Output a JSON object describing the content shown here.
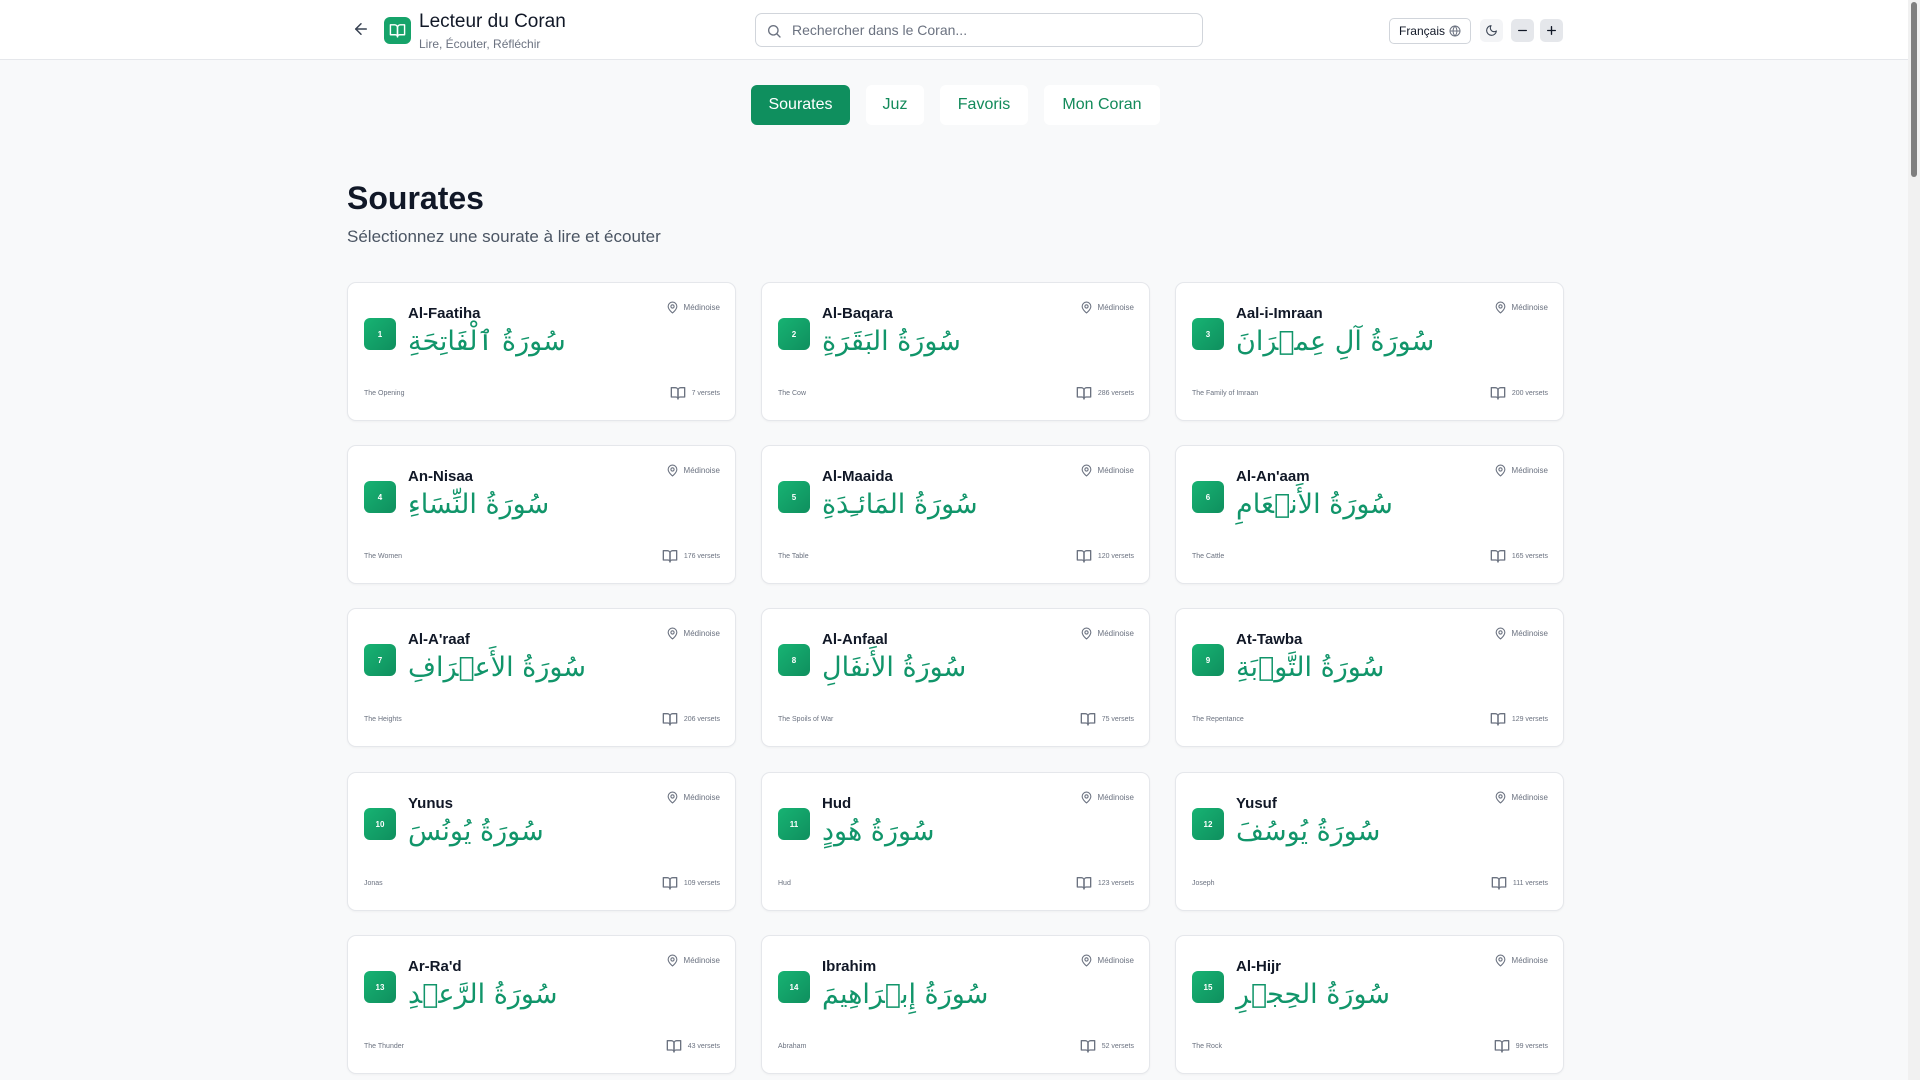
{
  "header": {
    "title": "Lecteur du Coran",
    "subtitle": "Lire, Écouter, Réfléchir",
    "search_placeholder": "Rechercher dans le Coran...",
    "language": "Français"
  },
  "tabs": [
    {
      "label": "Sourates",
      "active": true
    },
    {
      "label": "Juz",
      "active": false
    },
    {
      "label": "Favoris",
      "active": false
    },
    {
      "label": "Mon Coran",
      "active": false
    }
  ],
  "section": {
    "title": "Sourates",
    "subtitle": "Sélectionnez une sourate à lire et écouter"
  },
  "colors": {
    "accent": "#0f8f5e",
    "arabic": "#11956a"
  },
  "surahs": [
    {
      "number": "1",
      "name": "Al-Faatiha",
      "arabic": "سُورَةُ ٱلْفَاتِحَةِ",
      "english": "The Opening",
      "place": "Médinoise",
      "verses": "7 versets"
    },
    {
      "number": "2",
      "name": "Al-Baqara",
      "arabic": "سُورَةُ البَقَرَةِ",
      "english": "The Cow",
      "place": "Médinoise",
      "verses": "286 versets"
    },
    {
      "number": "3",
      "name": "Aal-i-Imraan",
      "arabic": "سُورَةُ آلِ عِمۡرَانَ",
      "english": "The Family of Imraan",
      "place": "Médinoise",
      "verses": "200 versets"
    },
    {
      "number": "4",
      "name": "An-Nisaa",
      "arabic": "سُورَةُ النِّسَاءِ",
      "english": "The Women",
      "place": "Médinoise",
      "verses": "176 versets"
    },
    {
      "number": "5",
      "name": "Al-Maaida",
      "arabic": "سُورَةُ المَائـِدَةِ",
      "english": "The Table",
      "place": "Médinoise",
      "verses": "120 versets"
    },
    {
      "number": "6",
      "name": "Al-An'aam",
      "arabic": "سُورَةُ الأَنۡعَامِ",
      "english": "The Cattle",
      "place": "Médinoise",
      "verses": "165 versets"
    },
    {
      "number": "7",
      "name": "Al-A'raaf",
      "arabic": "سُورَةُ الأَعۡرَافِ",
      "english": "The Heights",
      "place": "Médinoise",
      "verses": "206 versets"
    },
    {
      "number": "8",
      "name": "Al-Anfaal",
      "arabic": "سُورَةُ الأَنفَالِ",
      "english": "The Spoils of War",
      "place": "Médinoise",
      "verses": "75 versets"
    },
    {
      "number": "9",
      "name": "At-Tawba",
      "arabic": "سُورَةُ التَّوۡبَةِ",
      "english": "The Repentance",
      "place": "Médinoise",
      "verses": "129 versets"
    },
    {
      "number": "10",
      "name": "Yunus",
      "arabic": "سُورَةُ يُونُسَ",
      "english": "Jonas",
      "place": "Médinoise",
      "verses": "109 versets"
    },
    {
      "number": "11",
      "name": "Hud",
      "arabic": "سُورَةُ هُودٍ",
      "english": "Hud",
      "place": "Médinoise",
      "verses": "123 versets"
    },
    {
      "number": "12",
      "name": "Yusuf",
      "arabic": "سُورَةُ يُوسُفَ",
      "english": "Joseph",
      "place": "Médinoise",
      "verses": "111 versets"
    },
    {
      "number": "13",
      "name": "Ar-Ra'd",
      "arabic": "سُورَةُ الرَّعۡدِ",
      "english": "The Thunder",
      "place": "Médinoise",
      "verses": "43 versets"
    },
    {
      "number": "14",
      "name": "Ibrahim",
      "arabic": "سُورَةُ إِبۡرَاهِيمَ",
      "english": "Abraham",
      "place": "Médinoise",
      "verses": "52 versets"
    },
    {
      "number": "15",
      "name": "Al-Hijr",
      "arabic": "سُورَةُ الحِجۡرِ",
      "english": "The Rock",
      "place": "Médinoise",
      "verses": "99 versets"
    }
  ]
}
